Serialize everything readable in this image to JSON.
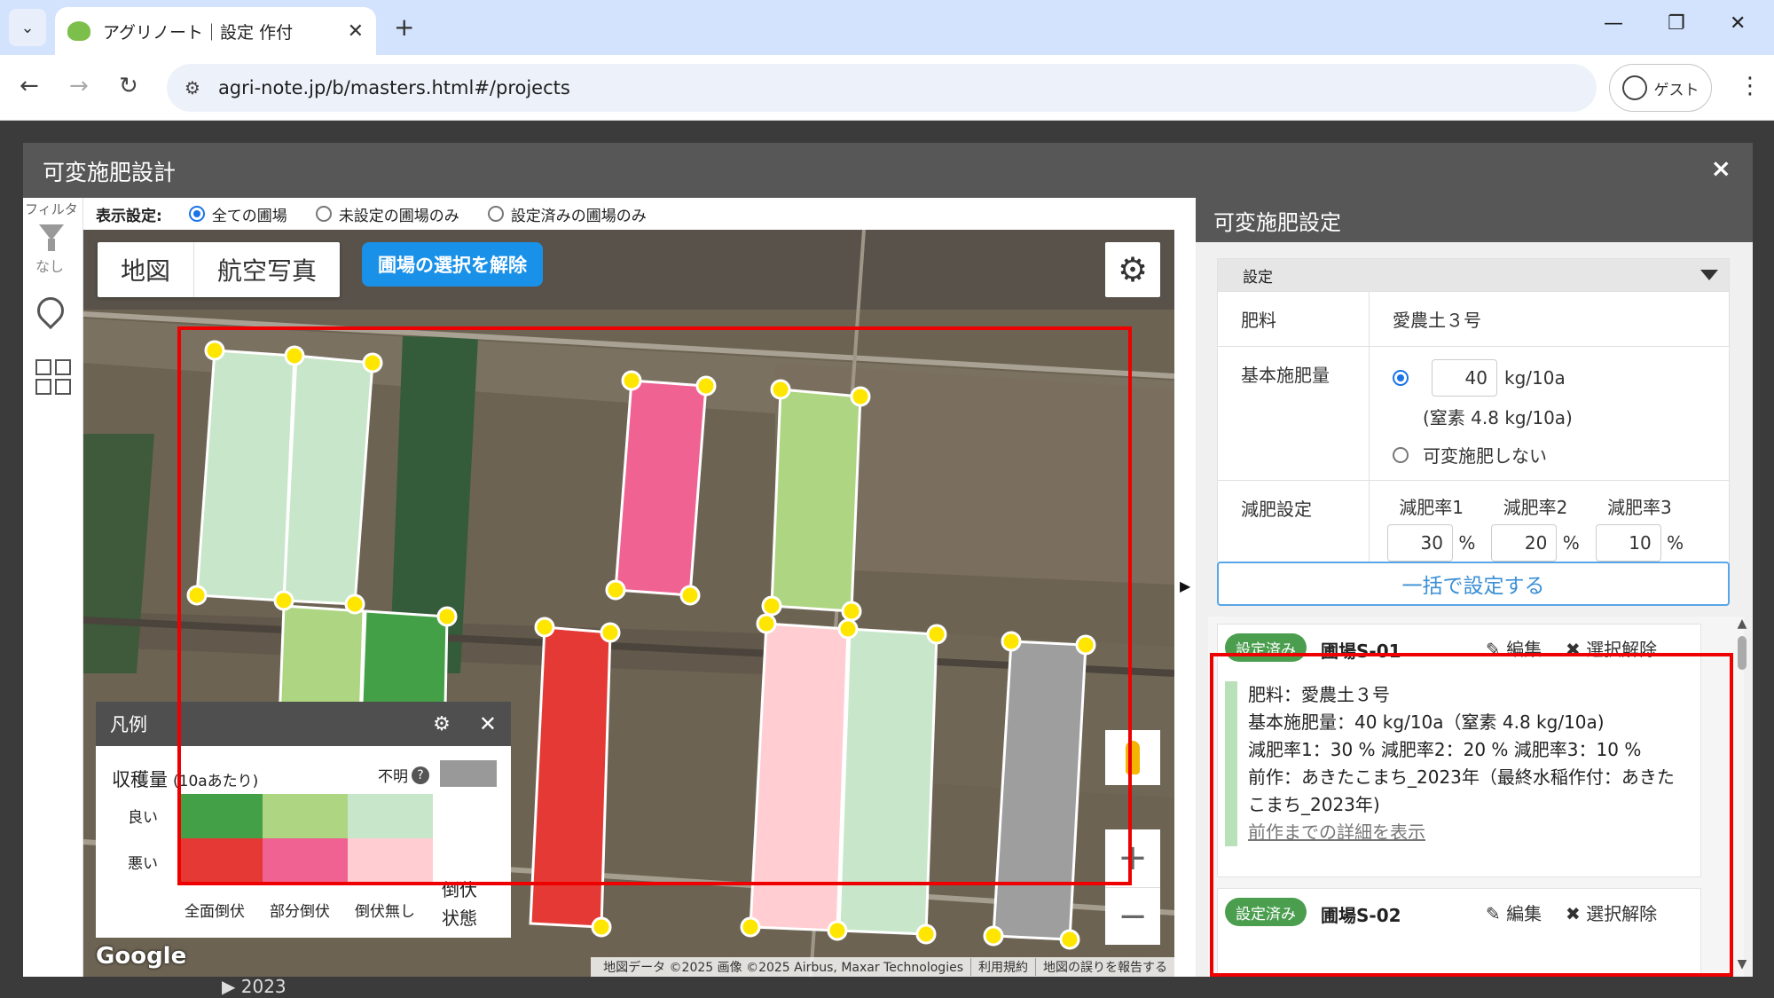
{
  "browser": {
    "tab_title": "アグリノート｜設定 作付",
    "url": "agri-note.jp/b/masters.html#/projects",
    "guest_label": "ゲスト"
  },
  "background": {
    "year_row": "▶ 2023"
  },
  "modal": {
    "title": "可変施肥設計",
    "close_glyph": "×",
    "sidebar": {
      "filter_label": "フィルタ",
      "filter_value": "なし"
    },
    "filter": {
      "label": "表示設定:",
      "options": [
        "全ての圃場",
        "未設定の圃場のみ",
        "設定済みの圃場のみ"
      ],
      "selected": "全ての圃場"
    },
    "map": {
      "type_tabs": [
        "地図",
        "航空写真"
      ],
      "deselect_button": "圃場の選択を解除",
      "google_logo": "Google",
      "attribution": [
        "地図データ ©2025 画像 ©2025 Airbus, Maxar Technologies",
        "利用規約",
        "地図の誤りを報告する"
      ],
      "field_colors": [
        "#c8e6c9",
        "#aed581",
        "#43a047",
        "#f06292",
        "#e53935",
        "#ffcdd2",
        "#9e9e9e"
      ]
    },
    "legend": {
      "title": "凡例",
      "yield_label": "収穫量",
      "yield_unit": "(10aあたり)",
      "unknown_label": "不明",
      "good_label": "良い",
      "bad_label": "悪い",
      "lodging_cols": [
        "全面倒伏",
        "部分倒伏",
        "倒伏無し"
      ],
      "lodging_state": [
        "倒伏",
        "状態"
      ],
      "colors": {
        "good": [
          "#43a047",
          "#aed581",
          "#c8e6c9"
        ],
        "bad": [
          "#e53935",
          "#f06292",
          "#ffcdd2"
        ],
        "unknown": "#9e9e9e"
      }
    },
    "panel": {
      "title": "可変施肥設定",
      "section": "設定",
      "fertilizer_label": "肥料",
      "fertilizer_value": "愛農土３号",
      "base_label": "基本施肥量",
      "base_amount": "40",
      "base_unit": "kg/10a",
      "nitrogen": "(窒素 4.8 kg/10a)",
      "no_variable": "可変施肥しない",
      "reduction_label": "減肥設定",
      "rates": [
        {
          "label": "減肥率1",
          "value": "30"
        },
        {
          "label": "減肥率2",
          "value": "20"
        },
        {
          "label": "減肥率3",
          "value": "10"
        }
      ],
      "percent": "%",
      "bulk_button": "一括で設定する",
      "cards": [
        {
          "badge": "設定済み",
          "name": "圃場S-01",
          "edit": "編集",
          "deselect": "選択解除",
          "lines": [
            "肥料：愛農土３号",
            "基本施肥量：40 kg/10a（窒素 4.8 kg/10a)",
            "減肥率1：30 %  減肥率2：20 %  減肥率3：10 %",
            "前作：あきたこまち_2023年（最終水稲作付：あきたこまち_2023年)"
          ],
          "link": "前作までの詳細を表示"
        },
        {
          "badge": "設定済み",
          "name": "圃場S-02",
          "edit": "編集",
          "deselect": "選択解除"
        }
      ]
    }
  }
}
